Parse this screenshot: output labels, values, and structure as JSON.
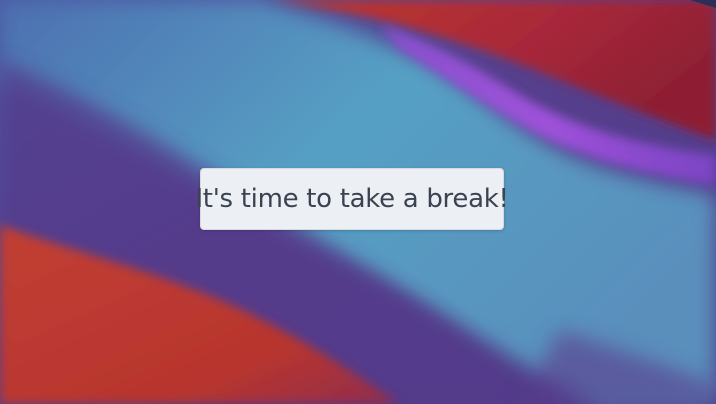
{
  "wallpaper": {
    "colors": {
      "blue": "#4f86b0",
      "purple": "#5a3f8e",
      "red": "#c0392b",
      "magenta": "#b150d6",
      "dark_navy": "#2b2f58"
    }
  },
  "break_notice": {
    "message": "It's time to take a break!",
    "background": "#eceff3",
    "text_color": "#3b4352"
  }
}
